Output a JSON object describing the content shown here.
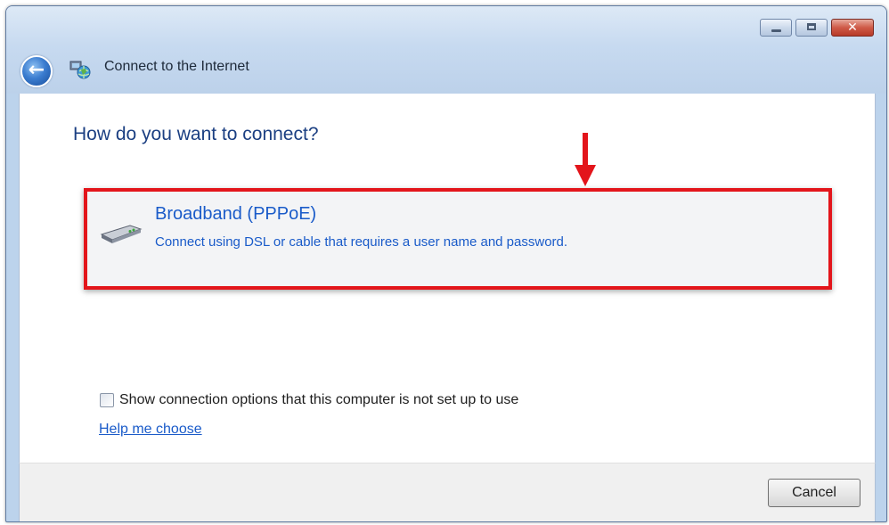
{
  "window": {
    "title": "Connect to the Internet",
    "close_glyph": "✕",
    "back_glyph": "←"
  },
  "main": {
    "heading": "How do you want to connect?",
    "option": {
      "title": "Broadband (PPPoE)",
      "description": "Connect using DSL or cable that requires a user name and password.",
      "icon": "modem-icon"
    },
    "show_options": {
      "label": "Show connection options that this computer is not set up to use",
      "checked": false
    },
    "help_link": "Help me choose"
  },
  "footer": {
    "cancel_label": "Cancel"
  },
  "colors": {
    "heading": "#1b3f82",
    "link": "#1a5bc9",
    "highlight": "#e3151b",
    "chrome": "#c7daf0"
  }
}
